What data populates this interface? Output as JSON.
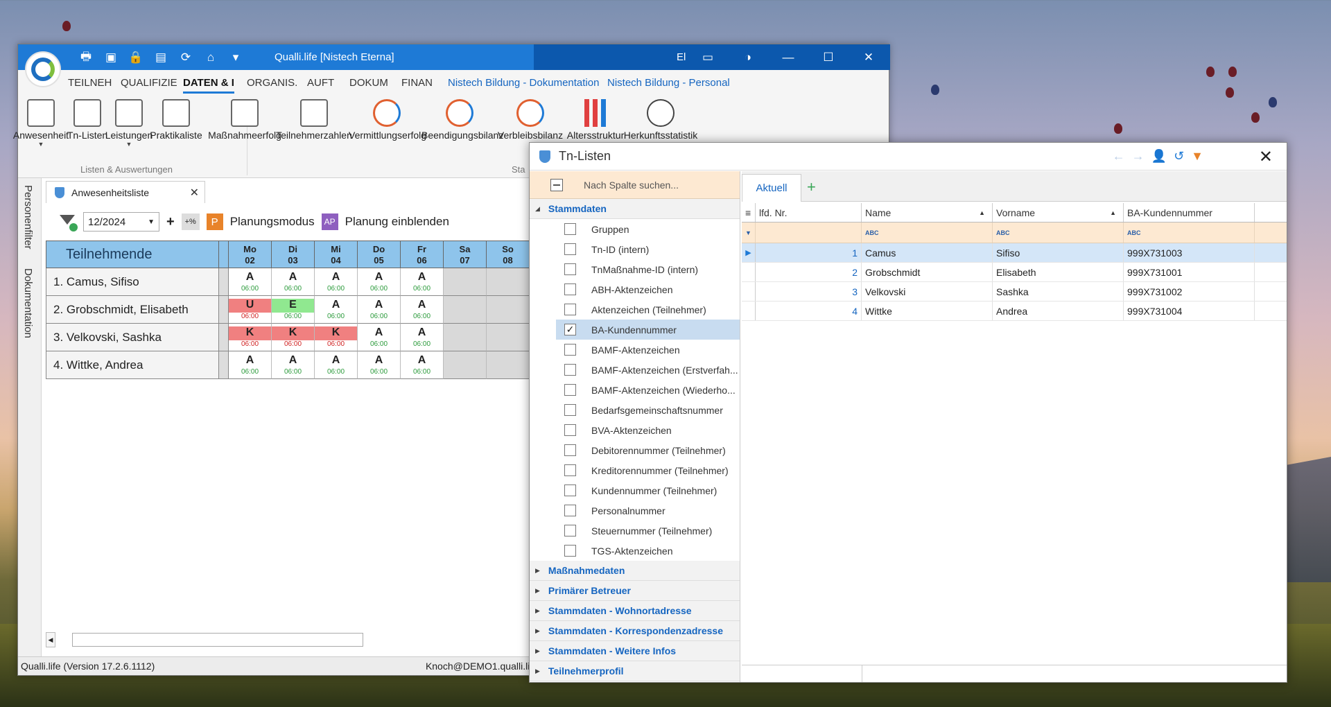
{
  "main_window": {
    "title": "Qualli.life [Nistech Eterna]",
    "title_extra": "El",
    "ribbon_tabs": [
      {
        "label": "TEILNEH",
        "active": false
      },
      {
        "label": "QUALIFIZIE",
        "active": false
      },
      {
        "label": "DATEN & I",
        "active": true
      },
      {
        "label": "ORGANIS.",
        "active": false
      },
      {
        "label": "AUFT",
        "active": false
      },
      {
        "label": "DOKUM",
        "active": false
      },
      {
        "label": "FINAN",
        "active": false
      },
      {
        "label": "Nistech Bildung - Dokumentation",
        "active": false
      },
      {
        "label": "Nistech Bildung - Personal",
        "active": false
      }
    ],
    "ribbon_buttons": [
      {
        "label": "Anwesenheit",
        "icon": "calendar-users-icon"
      },
      {
        "label": "Tn-Listen",
        "icon": "user-list-icon"
      },
      {
        "label": "Leistungen",
        "icon": "calculator-icon"
      },
      {
        "label": "Praktikaliste",
        "icon": "worker-icon"
      },
      {
        "label": "Maßnahmeerfolg",
        "icon": "report-chart-icon"
      },
      {
        "label": "Teilnehmerzahlen",
        "icon": "trend-chart-icon"
      },
      {
        "label": "Vermittlungserfolg",
        "icon": "pie-chart-icon"
      },
      {
        "label": "Beendigungsbilanz",
        "icon": "pie-chart-icon"
      },
      {
        "label": "Verbleibsbilanz",
        "icon": "pie-chart-icon"
      },
      {
        "label": "Altersstruktur",
        "icon": "bar-chart-icon"
      },
      {
        "label": "Herkunftsstatistik",
        "icon": "globe-users-icon"
      }
    ],
    "ribbon_group_1": "Listen & Auswertungen",
    "ribbon_group_2": "Sta",
    "vertical_tabs": [
      "Personenfilter",
      "Dokumentation"
    ],
    "doc_tab": "Anwesenheitsliste",
    "toolbar": {
      "month": "12/2024",
      "pct": "+%",
      "planning_badge": "P",
      "planning_label": "Planungsmodus",
      "show_planning_badge": "AP",
      "show_planning_label": "Planung einblenden"
    },
    "attendance": {
      "header": "Teilnehmende",
      "days": [
        {
          "dow": "Mo",
          "date": "02"
        },
        {
          "dow": "Di",
          "date": "03"
        },
        {
          "dow": "Mi",
          "date": "04"
        },
        {
          "dow": "Do",
          "date": "05"
        },
        {
          "dow": "Fr",
          "date": "06"
        },
        {
          "dow": "Sa",
          "date": "07"
        },
        {
          "dow": "So",
          "date": "08"
        }
      ],
      "rows": [
        {
          "name": "1.  Camus, Sifiso",
          "cells": [
            {
              "code": "A",
              "time": "06:00",
              "state": ""
            },
            {
              "code": "A",
              "time": "06:00",
              "state": ""
            },
            {
              "code": "A",
              "time": "06:00",
              "state": ""
            },
            {
              "code": "A",
              "time": "06:00",
              "state": ""
            },
            {
              "code": "A",
              "time": "06:00",
              "state": ""
            }
          ]
        },
        {
          "name": "2.  Grobschmidt, Elisabeth",
          "cells": [
            {
              "code": "U",
              "time": "06:00",
              "state": "red"
            },
            {
              "code": "E",
              "time": "06:00",
              "state": "green"
            },
            {
              "code": "A",
              "time": "06:00",
              "state": ""
            },
            {
              "code": "A",
              "time": "06:00",
              "state": ""
            },
            {
              "code": "A",
              "time": "06:00",
              "state": ""
            }
          ]
        },
        {
          "name": "3.  Velkovski, Sashka",
          "cells": [
            {
              "code": "K",
              "time": "06:00",
              "state": "red"
            },
            {
              "code": "K",
              "time": "06:00",
              "state": "red"
            },
            {
              "code": "K",
              "time": "06:00",
              "state": "red"
            },
            {
              "code": "A",
              "time": "06:00",
              "state": ""
            },
            {
              "code": "A",
              "time": "06:00",
              "state": ""
            }
          ]
        },
        {
          "name": "4.  Wittke, Andrea",
          "cells": [
            {
              "code": "A",
              "time": "06:00",
              "state": ""
            },
            {
              "code": "A",
              "time": "06:00",
              "state": ""
            },
            {
              "code": "A",
              "time": "06:00",
              "state": ""
            },
            {
              "code": "A",
              "time": "06:00",
              "state": ""
            },
            {
              "code": "A",
              "time": "06:00",
              "state": ""
            }
          ]
        }
      ]
    },
    "status_left": "Qualli.life (Version 17.2.6.1112)",
    "status_right": "Knoch@DEMO1.qualli.life"
  },
  "dialog": {
    "title": "Tn-Listen",
    "search_placeholder": "Nach Spalte suchen...",
    "open_category": "Stammdaten",
    "fields": [
      {
        "label": "Gruppen",
        "checked": false
      },
      {
        "label": "Tn-ID (intern)",
        "checked": false
      },
      {
        "label": "TnMaßnahme-ID (intern)",
        "checked": false
      },
      {
        "label": "ABH-Aktenzeichen",
        "checked": false
      },
      {
        "label": "Aktenzeichen (Teilnehmer)",
        "checked": false
      },
      {
        "label": "BA-Kundennummer",
        "checked": true
      },
      {
        "label": "BAMF-Aktenzeichen",
        "checked": false
      },
      {
        "label": "BAMF-Aktenzeichen (Erstverfah...",
        "checked": false
      },
      {
        "label": "BAMF-Aktenzeichen (Wiederho...",
        "checked": false
      },
      {
        "label": "Bedarfsgemeinschaftsnummer",
        "checked": false
      },
      {
        "label": "BVA-Aktenzeichen",
        "checked": false
      },
      {
        "label": "Debitorennummer (Teilnehmer)",
        "checked": false
      },
      {
        "label": "Kreditorennummer (Teilnehmer)",
        "checked": false
      },
      {
        "label": "Kundennummer (Teilnehmer)",
        "checked": false
      },
      {
        "label": "Personalnummer",
        "checked": false
      },
      {
        "label": "Steuernummer (Teilnehmer)",
        "checked": false
      },
      {
        "label": "TGS-Aktenzeichen",
        "checked": false
      }
    ],
    "collapsed_categories": [
      "Maßnahmedaten",
      "Primärer Betreuer",
      "Stammdaten - Wohnortadresse",
      "Stammdaten - Korrespondenzadresse",
      "Stammdaten - Weitere Infos",
      "Teilnehmerprofil"
    ],
    "tab": "Aktuell",
    "add_tab": "+",
    "grid": {
      "columns": [
        "lfd. Nr.",
        "Name",
        "Vorname",
        "BA-Kundennummer"
      ],
      "filter_icon": "ABC",
      "rows": [
        {
          "nr": "1",
          "name": "Camus",
          "vorname": "Sifiso",
          "ba": "999X731003"
        },
        {
          "nr": "2",
          "name": "Grobschmidt",
          "vorname": "Elisabeth",
          "ba": "999X731001"
        },
        {
          "nr": "3",
          "name": "Velkovski",
          "vorname": "Sashka",
          "ba": "999X731002"
        },
        {
          "nr": "4",
          "name": "Wittke",
          "vorname": "Andrea",
          "ba": "999X731004"
        }
      ]
    }
  }
}
